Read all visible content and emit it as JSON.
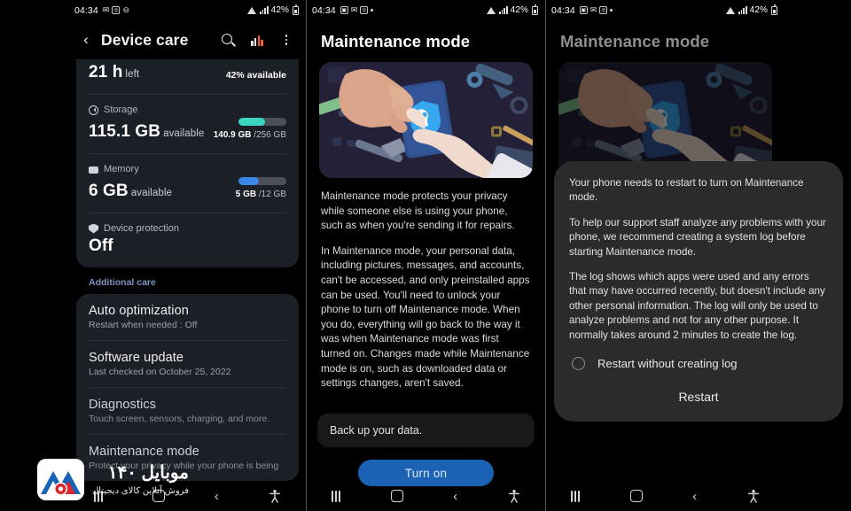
{
  "status_bar": {
    "time": "04:34",
    "battery": "42%",
    "icons_left_p1": [
      "message-icon",
      "instagram-icon",
      "dnd-icon"
    ],
    "icons_left_p2": [
      "gallery-icon",
      "message-icon",
      "instagram-icon",
      "dot-icon"
    ],
    "icons_right": [
      "wifi-icon",
      "signal-icon",
      "battery-icon"
    ]
  },
  "panel1": {
    "appbar": {
      "back": "‹",
      "title": "Device care",
      "search_icon": "search-icon",
      "chart_icon": "bar-chart-icon",
      "menu_icon": "more-options-icon"
    },
    "battery_row": {
      "value": "21 h",
      "unit": "left",
      "right": "42% available"
    },
    "resources": [
      {
        "icon": "storage-icon",
        "label": "Storage",
        "value": "115.1 GB",
        "value_suffix": "available",
        "used": "140.9 GB",
        "total": "/256 GB",
        "fill_pct": 55,
        "bar_color": "#3ad6c2"
      },
      {
        "icon": "memory-icon",
        "label": "Memory",
        "value": "6 GB",
        "value_suffix": "available",
        "used": "5 GB",
        "total": "/12 GB",
        "fill_pct": 42,
        "bar_color": "#3b87e8"
      },
      {
        "icon": "shield-icon",
        "label": "Device protection",
        "value": "Off",
        "value_suffix": "",
        "used": "",
        "total": "",
        "fill_pct": 0,
        "bar_color": ""
      }
    ],
    "section_label": "Additional care",
    "list": [
      {
        "title": "Auto optimization",
        "sub": "Restart when needed : Off"
      },
      {
        "title": "Software update",
        "sub": "Last checked on October 25, 2022"
      },
      {
        "title": "Diagnostics",
        "sub": "Touch screen, sensors, charging, and more."
      },
      {
        "title": "Maintenance mode",
        "sub": "Protect your privacy while your phone is being"
      }
    ]
  },
  "panel2": {
    "title": "Maintenance mode",
    "illustration": "maintenance-mode-illustration",
    "paragraphs": [
      "Maintenance mode protects your privacy while someone else is using your phone, such as when you're sending it for repairs.",
      "In Maintenance mode, your personal data, including pictures, messages, and accounts, can't be accessed, and only preinstalled apps can be used. You'll need to unlock your phone to turn off Maintenance mode. When you do, everything will go back to the way it was when Maintenance mode was first turned on. Changes made while Maintenance mode is on, such as downloaded data or settings changes, aren't saved."
    ],
    "backup_card": "Back up your data.",
    "primary_button": "Turn on",
    "button_color": "#1b62b5"
  },
  "panel3": {
    "title": "Maintenance mode",
    "illustration": "maintenance-mode-illustration",
    "dialog": {
      "paragraphs": [
        "Your phone needs to restart to turn on Maintenance mode.",
        "To help our support staff analyze any problems with your phone, we recommend creating a system log before starting Maintenance mode.",
        "The log shows which apps were used and any errors that may have occurred recently, but doesn't include any other personal information. The log will only be used to analyze problems and not for any other purpose. It normally takes around 2 minutes to create the log."
      ],
      "option_label": "Restart without creating log",
      "option_icon": "radio-unselected-icon",
      "action": "Restart"
    }
  },
  "navbar": {
    "recents": "recents-icon",
    "home": "home-icon",
    "back": "back-icon",
    "accessibility": "accessibility-icon"
  },
  "watermark": {
    "title": "موبایل ۱۴۰",
    "subtitle": "فروش آنلاین کالای دیجیتال",
    "logo": "mobile140-logo"
  }
}
